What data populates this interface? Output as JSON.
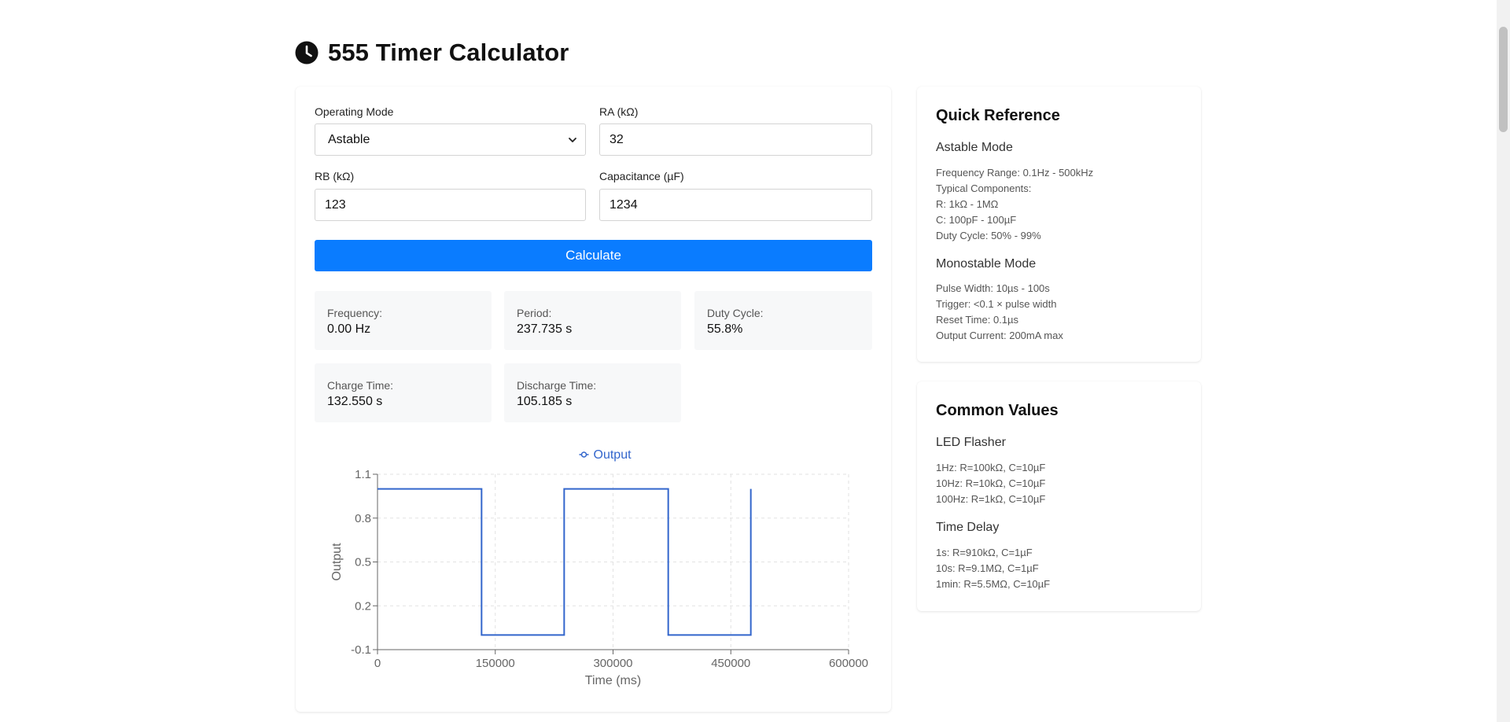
{
  "header": {
    "title": "555 Timer Calculator",
    "icon": "clock-icon"
  },
  "form": {
    "mode_label": "Operating Mode",
    "mode_value": "Astable",
    "ra_label": "RA (kΩ)",
    "ra_value": "32",
    "rb_label": "RB (kΩ)",
    "rb_value": "123",
    "cap_label": "Capacitance (µF)",
    "cap_value": "1234",
    "calculate_label": "Calculate"
  },
  "results": {
    "frequency_label": "Frequency:",
    "frequency_value": "0.00 Hz",
    "period_label": "Period:",
    "period_value": "237.735 s",
    "duty_label": "Duty Cycle:",
    "duty_value": "55.8%",
    "charge_label": "Charge Time:",
    "charge_value": "132.550 s",
    "discharge_label": "Discharge Time:",
    "discharge_value": "105.185 s"
  },
  "chart_data": {
    "type": "line",
    "title": "",
    "xlabel": "Time (ms)",
    "ylabel": "Output",
    "xlim": [
      0,
      600000
    ],
    "ylim": [
      -0.1,
      1.1
    ],
    "xticks": [
      0,
      150000,
      300000,
      450000,
      600000
    ],
    "yticks": [
      -0.1,
      0.2,
      0.5,
      0.8,
      1.1
    ],
    "grid": true,
    "legend_position": "top",
    "series": [
      {
        "name": "Output",
        "color": "#3366cc",
        "x": [
          0,
          132550,
          132550,
          237735,
          237735,
          370285,
          370285,
          475470,
          475470
        ],
        "y": [
          1,
          1,
          0,
          0,
          1,
          1,
          0,
          0,
          1
        ]
      }
    ]
  },
  "quick_reference": {
    "title": "Quick Reference",
    "astable_heading": "Astable Mode",
    "astable_lines": [
      "Frequency Range: 0.1Hz - 500kHz",
      "Typical Components:",
      "R: 1kΩ - 1MΩ",
      "C: 100pF - 100µF",
      "Duty Cycle: 50% - 99%"
    ],
    "monostable_heading": "Monostable Mode",
    "monostable_lines": [
      "Pulse Width: 10µs - 100s",
      "Trigger: <0.1 × pulse width",
      "Reset Time: 0.1µs",
      "Output Current: 200mA max"
    ]
  },
  "common_values": {
    "title": "Common Values",
    "led_heading": "LED Flasher",
    "led_lines": [
      "1Hz: R=100kΩ, C=10µF",
      "10Hz: R=10kΩ, C=10µF",
      "100Hz: R=1kΩ, C=10µF"
    ],
    "delay_heading": "Time Delay",
    "delay_lines": [
      "1s: R=910kΩ, C=1µF",
      "10s: R=9.1MΩ, C=1µF",
      "1min: R=5.5MΩ, C=10µF"
    ]
  }
}
